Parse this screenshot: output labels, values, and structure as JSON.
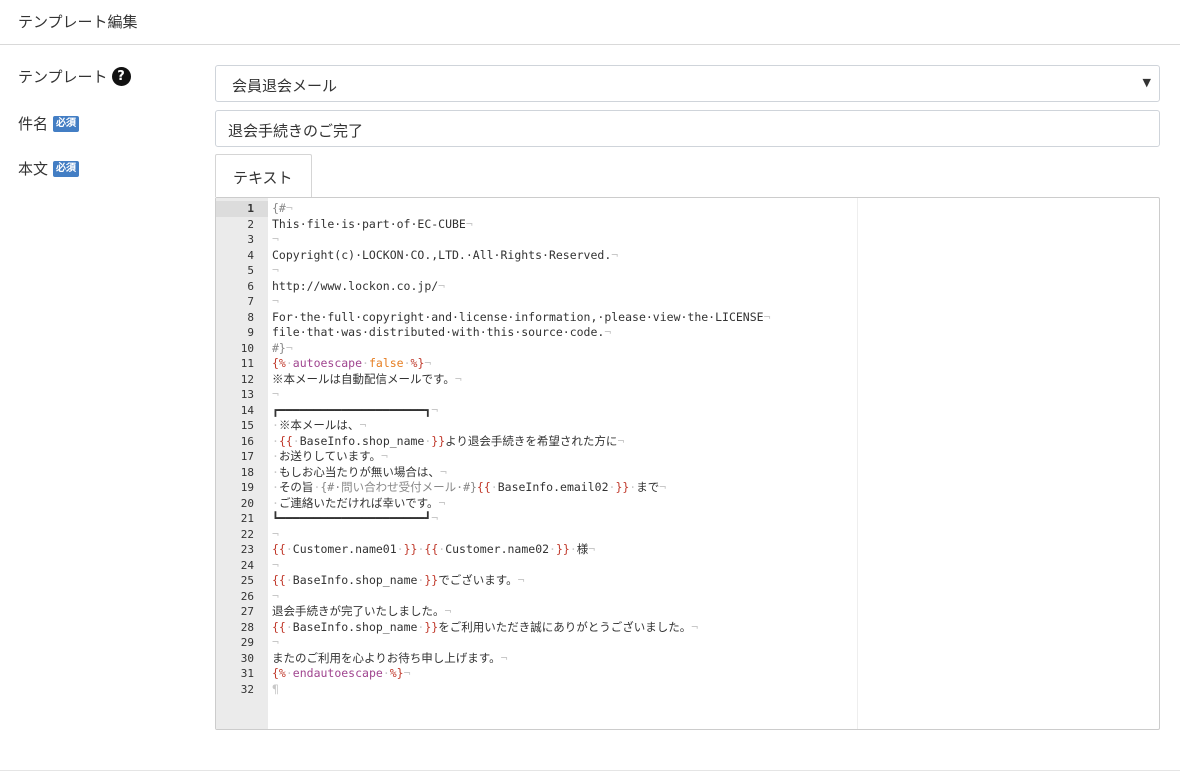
{
  "header": {
    "title": "テンプレート編集"
  },
  "form": {
    "template_label": "テンプレート",
    "template_help": "?",
    "template_value": "会員退会メール",
    "template_arrow": "▼",
    "subject_label": "件名",
    "body_label": "本文",
    "required_badge": "必須",
    "subject_value": "退会手続きのご完了"
  },
  "tabs": [
    {
      "label": "テキスト"
    }
  ],
  "colors": {
    "required": "#437ec4",
    "delimiter": "#c0392b",
    "keyword": "#a0458f",
    "value": "#e67e22",
    "comment": "#888888",
    "invisible": "#c8c8c8"
  },
  "editor": {
    "active_line": 1,
    "lines": [
      [
        [
          "c",
          "{#"
        ]
      ],
      [
        [
          "t",
          "This·file·is·part·of·EC-CUBE"
        ]
      ],
      [],
      [
        [
          "t",
          "Copyright(c)·LOCKON·CO.,LTD.·All·Rights·Reserved."
        ]
      ],
      [],
      [
        [
          "t",
          "http://www.lockon.co.jp/"
        ]
      ],
      [],
      [
        [
          "t",
          "For·the·full·copyright·and·license·information,·please·view·the·LICENSE"
        ]
      ],
      [
        [
          "t",
          "file·that·was·distributed·with·this·source·code."
        ]
      ],
      [
        [
          "c",
          "#}"
        ]
      ],
      [
        [
          "d",
          "{%"
        ],
        [
          "i",
          "·"
        ],
        [
          "k",
          "autoescape"
        ],
        [
          "i",
          "·"
        ],
        [
          "v",
          "false"
        ],
        [
          "i",
          "·"
        ],
        [
          "d",
          "%}"
        ]
      ],
      [
        [
          "t",
          "※本メールは自動配信メールです。"
        ]
      ],
      [],
      [
        [
          "t",
          "┏━━━━━━━━━━━━━━━━━━━━━┓"
        ]
      ],
      [
        [
          "i",
          "·"
        ],
        [
          "t",
          "※本メールは、"
        ]
      ],
      [
        [
          "i",
          "·"
        ],
        [
          "d",
          "{{"
        ],
        [
          "i",
          "·"
        ],
        [
          "t",
          "BaseInfo.shop_name"
        ],
        [
          "i",
          "·"
        ],
        [
          "d",
          "}}"
        ],
        [
          "t",
          "より退会手続きを希望された方に"
        ]
      ],
      [
        [
          "i",
          "·"
        ],
        [
          "t",
          "お送りしています。"
        ]
      ],
      [
        [
          "i",
          "·"
        ],
        [
          "t",
          "もしお心当たりが無い場合は、"
        ]
      ],
      [
        [
          "i",
          "·"
        ],
        [
          "t",
          "その旨"
        ],
        [
          "i",
          "·"
        ],
        [
          "c",
          "{#·問い合わせ受付メール·#}"
        ],
        [
          "d",
          "{{"
        ],
        [
          "i",
          "·"
        ],
        [
          "t",
          "BaseInfo.email02"
        ],
        [
          "i",
          "·"
        ],
        [
          "d",
          "}}"
        ],
        [
          "i",
          "·"
        ],
        [
          "t",
          "まで"
        ]
      ],
      [
        [
          "i",
          "·"
        ],
        [
          "t",
          "ご連絡いただければ幸いです。"
        ]
      ],
      [
        [
          "t",
          "┗━━━━━━━━━━━━━━━━━━━━━┛"
        ]
      ],
      [],
      [
        [
          "d",
          "{{"
        ],
        [
          "i",
          "·"
        ],
        [
          "t",
          "Customer.name01"
        ],
        [
          "i",
          "·"
        ],
        [
          "d",
          "}}"
        ],
        [
          "i",
          "·"
        ],
        [
          "d",
          "{{"
        ],
        [
          "i",
          "·"
        ],
        [
          "t",
          "Customer.name02"
        ],
        [
          "i",
          "·"
        ],
        [
          "d",
          "}}"
        ],
        [
          "i",
          "·"
        ],
        [
          "t",
          "様"
        ]
      ],
      [],
      [
        [
          "d",
          "{{"
        ],
        [
          "i",
          "·"
        ],
        [
          "t",
          "BaseInfo.shop_name"
        ],
        [
          "i",
          "·"
        ],
        [
          "d",
          "}}"
        ],
        [
          "t",
          "でございます。"
        ]
      ],
      [],
      [
        [
          "t",
          "退会手続きが完了いたしました。"
        ]
      ],
      [
        [
          "d",
          "{{"
        ],
        [
          "i",
          "·"
        ],
        [
          "t",
          "BaseInfo.shop_name"
        ],
        [
          "i",
          "·"
        ],
        [
          "d",
          "}}"
        ],
        [
          "t",
          "をご利用いただき誠にありがとうございました。"
        ]
      ],
      [],
      [
        [
          "t",
          "またのご利用を心よりお待ち申し上げます。"
        ]
      ],
      [
        [
          "d",
          "{%"
        ],
        [
          "i",
          "·"
        ],
        [
          "k",
          "endautoescape"
        ],
        [
          "i",
          "·"
        ],
        [
          "d",
          "%}"
        ]
      ],
      []
    ],
    "eol_marker": "¬",
    "eof_marker": "¶"
  }
}
